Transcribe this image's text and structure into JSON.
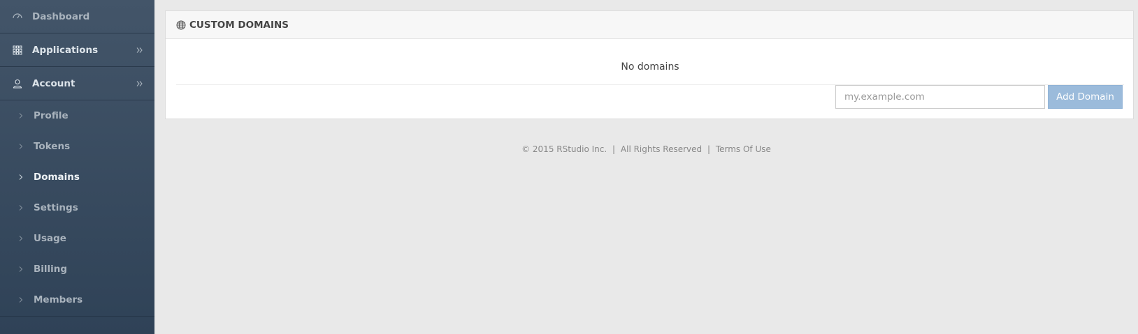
{
  "sidebar": {
    "items": [
      {
        "label": "Dashboard",
        "icon": "dashboard-icon"
      },
      {
        "label": "Applications",
        "icon": "grid-icon"
      },
      {
        "label": "Account",
        "icon": "user-icon"
      }
    ],
    "sub_items": [
      {
        "label": "Profile"
      },
      {
        "label": "Tokens"
      },
      {
        "label": "Domains",
        "active": true
      },
      {
        "label": "Settings"
      },
      {
        "label": "Usage"
      },
      {
        "label": "Billing"
      },
      {
        "label": "Members"
      }
    ]
  },
  "panel": {
    "title": "CUSTOM DOMAINS",
    "icon": "globe-icon",
    "empty_text": "No domains",
    "input_placeholder": "my.example.com",
    "input_value": "",
    "add_button_label": "Add Domain"
  },
  "footer": {
    "copyright": "© 2015 RStudio Inc.",
    "rights": "All Rights Reserved",
    "terms_link": "Terms Of Use",
    "separator": "|"
  },
  "colors": {
    "sidebar_top": "#435569",
    "sidebar_bottom": "#2f4257",
    "page_bg": "#e9e9e9",
    "button_bg": "#9bbbdb"
  }
}
